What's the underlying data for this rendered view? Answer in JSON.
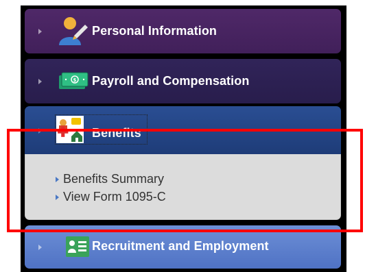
{
  "top_fragment": "...",
  "panels": {
    "personal": {
      "label": "Personal Information",
      "icon": "person-icon"
    },
    "payroll": {
      "label": "Payroll and Compensation",
      "icon": "money-icon"
    },
    "benefits": {
      "label": "Benefits",
      "icon": "benefits-icon"
    },
    "recruitment": {
      "label": "Recruitment and Employment",
      "icon": "id-card-icon"
    }
  },
  "benefits_items": [
    {
      "label": "Benefits Summary"
    },
    {
      "label": "View Form 1095-C"
    }
  ],
  "colors": {
    "personal_bg": "#4f2868",
    "payroll_bg": "#312459",
    "benefits_bg": "#2a4e93",
    "recruitment_bg": "#6d8fd6",
    "highlight": "#ff0000"
  }
}
